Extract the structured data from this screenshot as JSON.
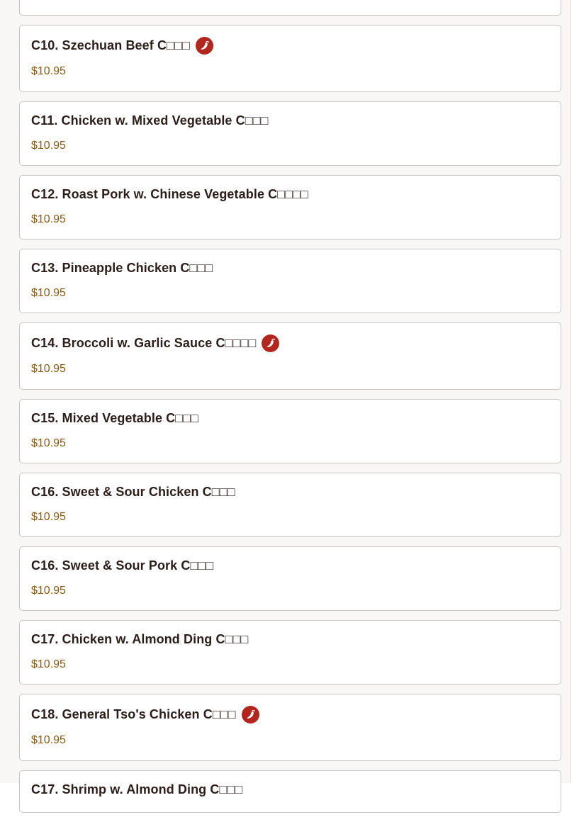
{
  "menu": {
    "items": [
      {
        "title": "",
        "price": "",
        "spicy": false,
        "cut": "top"
      },
      {
        "title": "C10. Szechuan Beef C□□□",
        "price": "$10.95",
        "spicy": true
      },
      {
        "title": "C11. Chicken w. Mixed Vegetable C□□□",
        "price": "$10.95",
        "spicy": false
      },
      {
        "title": "C12. Roast Pork w. Chinese Vegetable C□□□□",
        "price": "$10.95",
        "spicy": false
      },
      {
        "title": "C13. Pineapple Chicken C□□□",
        "price": "$10.95",
        "spicy": false
      },
      {
        "title": "C14. Broccoli w. Garlic Sauce C□□□□",
        "price": "$10.95",
        "spicy": true
      },
      {
        "title": "C15. Mixed Vegetable C□□□",
        "price": "$10.95",
        "spicy": false
      },
      {
        "title": "C16. Sweet & Sour Chicken C□□□",
        "price": "$10.95",
        "spicy": false
      },
      {
        "title": "C16. Sweet & Sour Pork C□□□",
        "price": "$10.95",
        "spicy": false
      },
      {
        "title": "C17. Chicken w. Almond Ding C□□□",
        "price": "$10.95",
        "spicy": false
      },
      {
        "title": "C18. General Tso's Chicken C□□□",
        "price": "$10.95",
        "spicy": true
      },
      {
        "title": "C17. Shrimp w. Almond Ding C□□□",
        "price": "",
        "spicy": false,
        "cut": "bottom"
      }
    ]
  },
  "icons": {
    "spicy": "chili-pepper-icon"
  },
  "colors": {
    "title": "#2b1d1a",
    "price": "#8a5a12",
    "spicy_badge": "#b3261e",
    "card_border": "#c9c6c2",
    "page_background": "#f8f7f5"
  }
}
